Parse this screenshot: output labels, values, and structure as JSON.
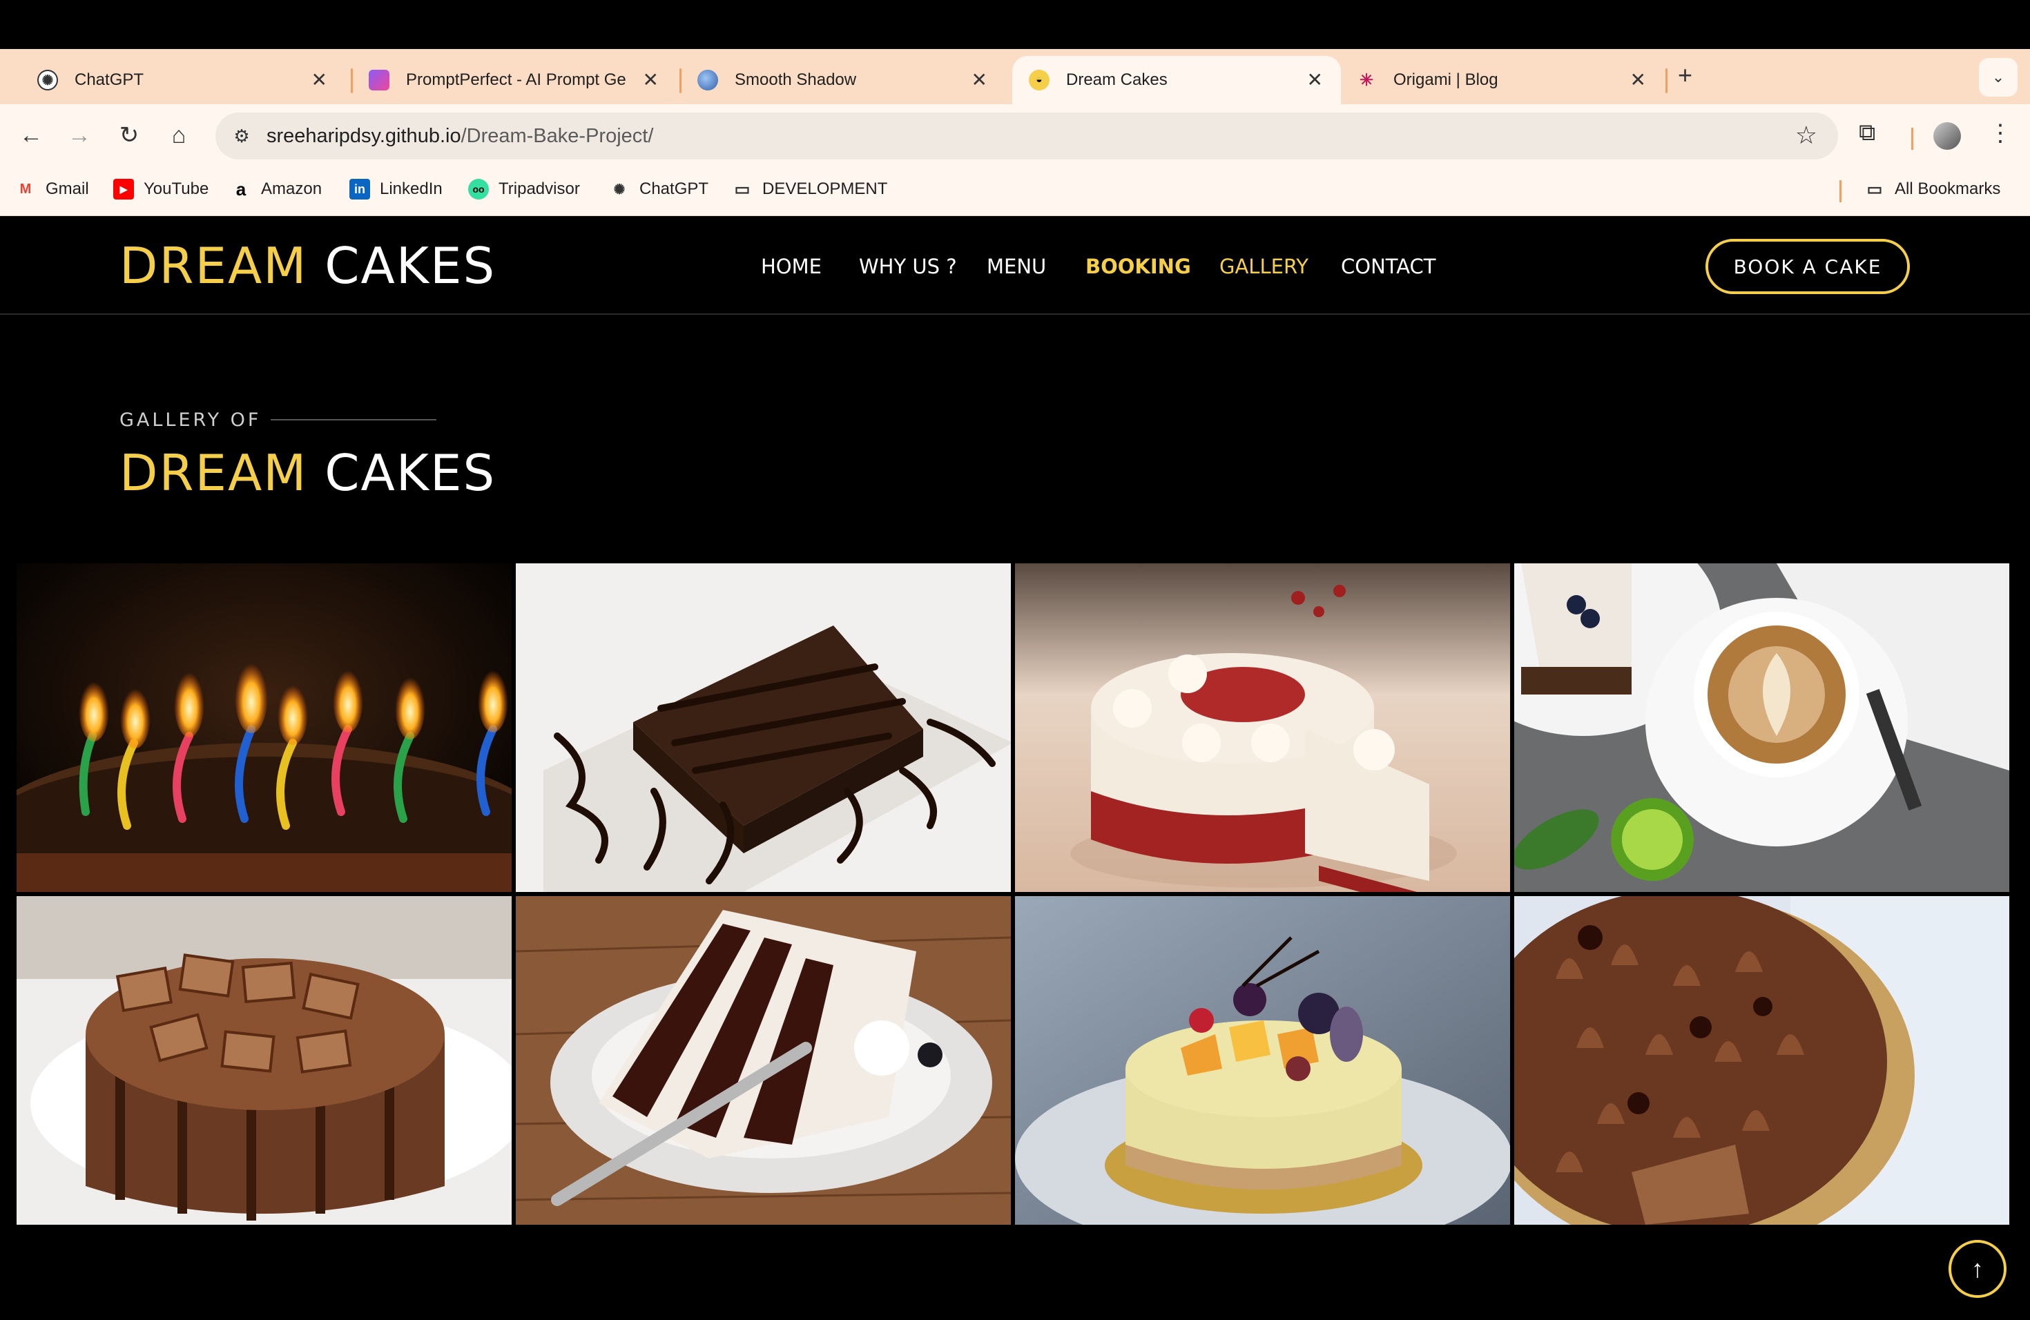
{
  "browser": {
    "tabs": [
      {
        "title": "ChatGPT",
        "icon": "chatgpt-icon"
      },
      {
        "title": "PromptPerfect - AI Prompt Ge",
        "icon": "promptperfect-icon"
      },
      {
        "title": "Smooth Shadow",
        "icon": "smooth-shadow-icon"
      },
      {
        "title": "Dream Cakes",
        "icon": "dream-cakes-icon",
        "active": true
      },
      {
        "title": "Origami | Blog",
        "icon": "origami-icon"
      }
    ],
    "url_host": "sreeharipdsy.github.io",
    "url_path": "/Dream-Bake-Project/",
    "bookmarks": [
      {
        "label": "Gmail",
        "icon": "gmail-icon"
      },
      {
        "label": "YouTube",
        "icon": "youtube-icon"
      },
      {
        "label": "Amazon",
        "icon": "amazon-icon"
      },
      {
        "label": "LinkedIn",
        "icon": "linkedin-icon"
      },
      {
        "label": "Tripadvisor",
        "icon": "tripadvisor-icon"
      },
      {
        "label": "ChatGPT",
        "icon": "chatgpt-icon"
      },
      {
        "label": "DEVELOPMENT",
        "icon": "folder-icon"
      }
    ],
    "all_bookmarks": "All Bookmarks"
  },
  "site": {
    "logo_part1": "DREAM",
    "logo_part2": "CAKES",
    "nav": [
      "HOME",
      "WHY US ?",
      "MENU",
      "BOOKING",
      "GALLERY",
      "CONTACT"
    ],
    "cta": "BOOK A CAKE",
    "accent_color": "#f5cf4a",
    "section_subtitle": "GALLERY OF",
    "section_title_part1": "DREAM",
    "section_title_part2": "CAKES",
    "gallery": [
      "birthday-cake-candles",
      "chocolate-brownie-drizzle",
      "red-velvet-cake",
      "cake-slice-cappuccino",
      "chocolate-wafer-cake",
      "black-forest-slice",
      "fruit-cheesecake",
      "chocolate-truffle-cake"
    ]
  }
}
